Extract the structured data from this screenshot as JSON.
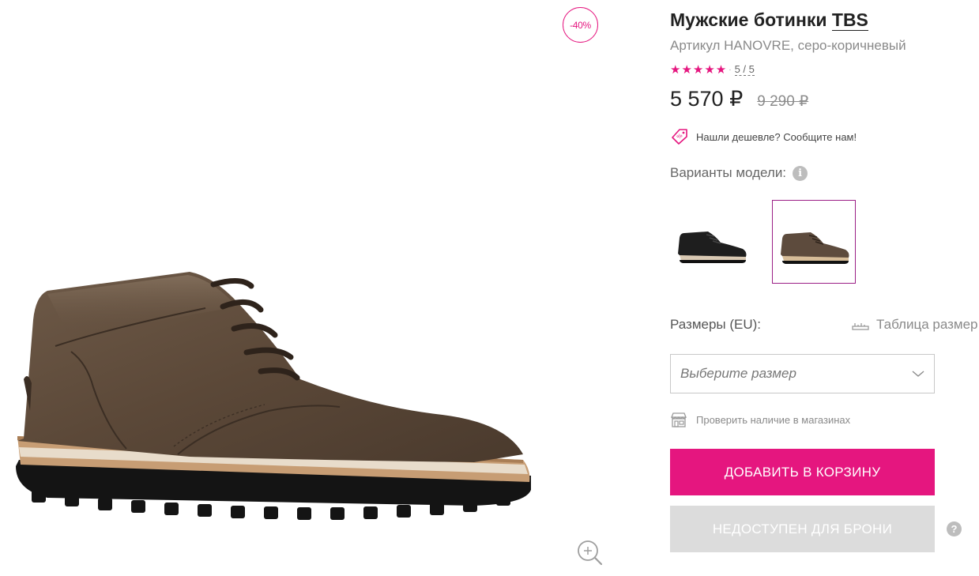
{
  "gallery": {
    "discount_badge": "-40%",
    "main_image_icon": "brown-leather-chukka-boot",
    "zoom_icon": "zoom-in-icon"
  },
  "product": {
    "title_prefix": "Мужские ботинки",
    "brand": "TBS",
    "sku_line": "Артикул HANOVRE, серо-коричневый",
    "rating_stars": "★★★★★",
    "rating_score": "5 / 5",
    "price_current": "5 570 ₽",
    "price_old": "9 290 ₽",
    "cheaper_text": "Нашли дешевле? Сообщите нам!",
    "variants_label": "Варианты модели:",
    "variants": [
      {
        "icon": "black-boot-thumbnail",
        "color": "#1e1e1e",
        "selected": false
      },
      {
        "icon": "brown-boot-thumbnail",
        "color": "#5d4b3d",
        "selected": true
      }
    ],
    "sizes_label": "Размеры (EU):",
    "size_table_link": "Таблица размер",
    "size_select_placeholder": "Выберите размер",
    "check_stores_text": "Проверить наличие в магазинах",
    "add_to_cart_label": "ДОБАВИТЬ В КОРЗИНУ",
    "reserve_label": "НЕДОСТУПЕН ДЛЯ БРОНИ",
    "help_glyph": "?",
    "info_glyph": "i"
  },
  "colors": {
    "accent": "#e5167f",
    "selected_border": "#9b1f86",
    "disabled_button": "#dcdcdc",
    "boot_leather": "#5d4b3d",
    "boot_sole": "#111111"
  }
}
